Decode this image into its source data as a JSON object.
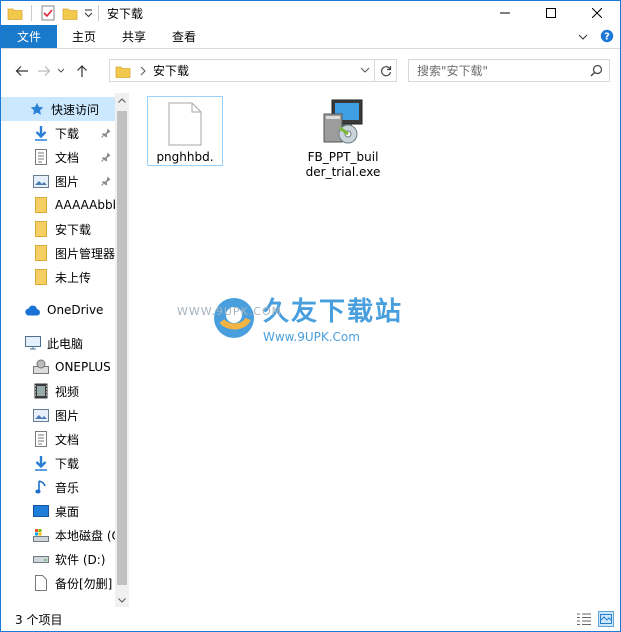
{
  "window": {
    "title": "安下载"
  },
  "ribbon": {
    "tabs": [
      "文件",
      "主页",
      "共享",
      "查看"
    ]
  },
  "address": {
    "crumb": "安下载"
  },
  "search": {
    "placeholder": "搜索\"安下载\""
  },
  "nav": {
    "quick_access": "快速访问",
    "quick_items": [
      "下载",
      "文档",
      "图片",
      "AAAAAbbb",
      "安下载",
      "图片管理器",
      "未上传"
    ],
    "onedrive": "OneDrive",
    "this_pc": "此电脑",
    "pc_items": [
      "ONEPLUS",
      "视频",
      "图片",
      "文档",
      "下载",
      "音乐",
      "桌面",
      "本地磁盘 (C",
      "软件 (D:)",
      "备份[勿删]"
    ]
  },
  "files": [
    {
      "name": "pnghhbd."
    },
    {
      "name": "FB_PPT_builder_trial.exe"
    }
  ],
  "watermark": {
    "small": "WWW.9UPK.COM",
    "title": "久友下载站",
    "url": "Www.9UPK.Com"
  },
  "status": {
    "count": "3 个项目"
  },
  "colors": {
    "file_tab": "#1979ca",
    "selection": "#cce8ff",
    "border": "#1e78d6"
  }
}
